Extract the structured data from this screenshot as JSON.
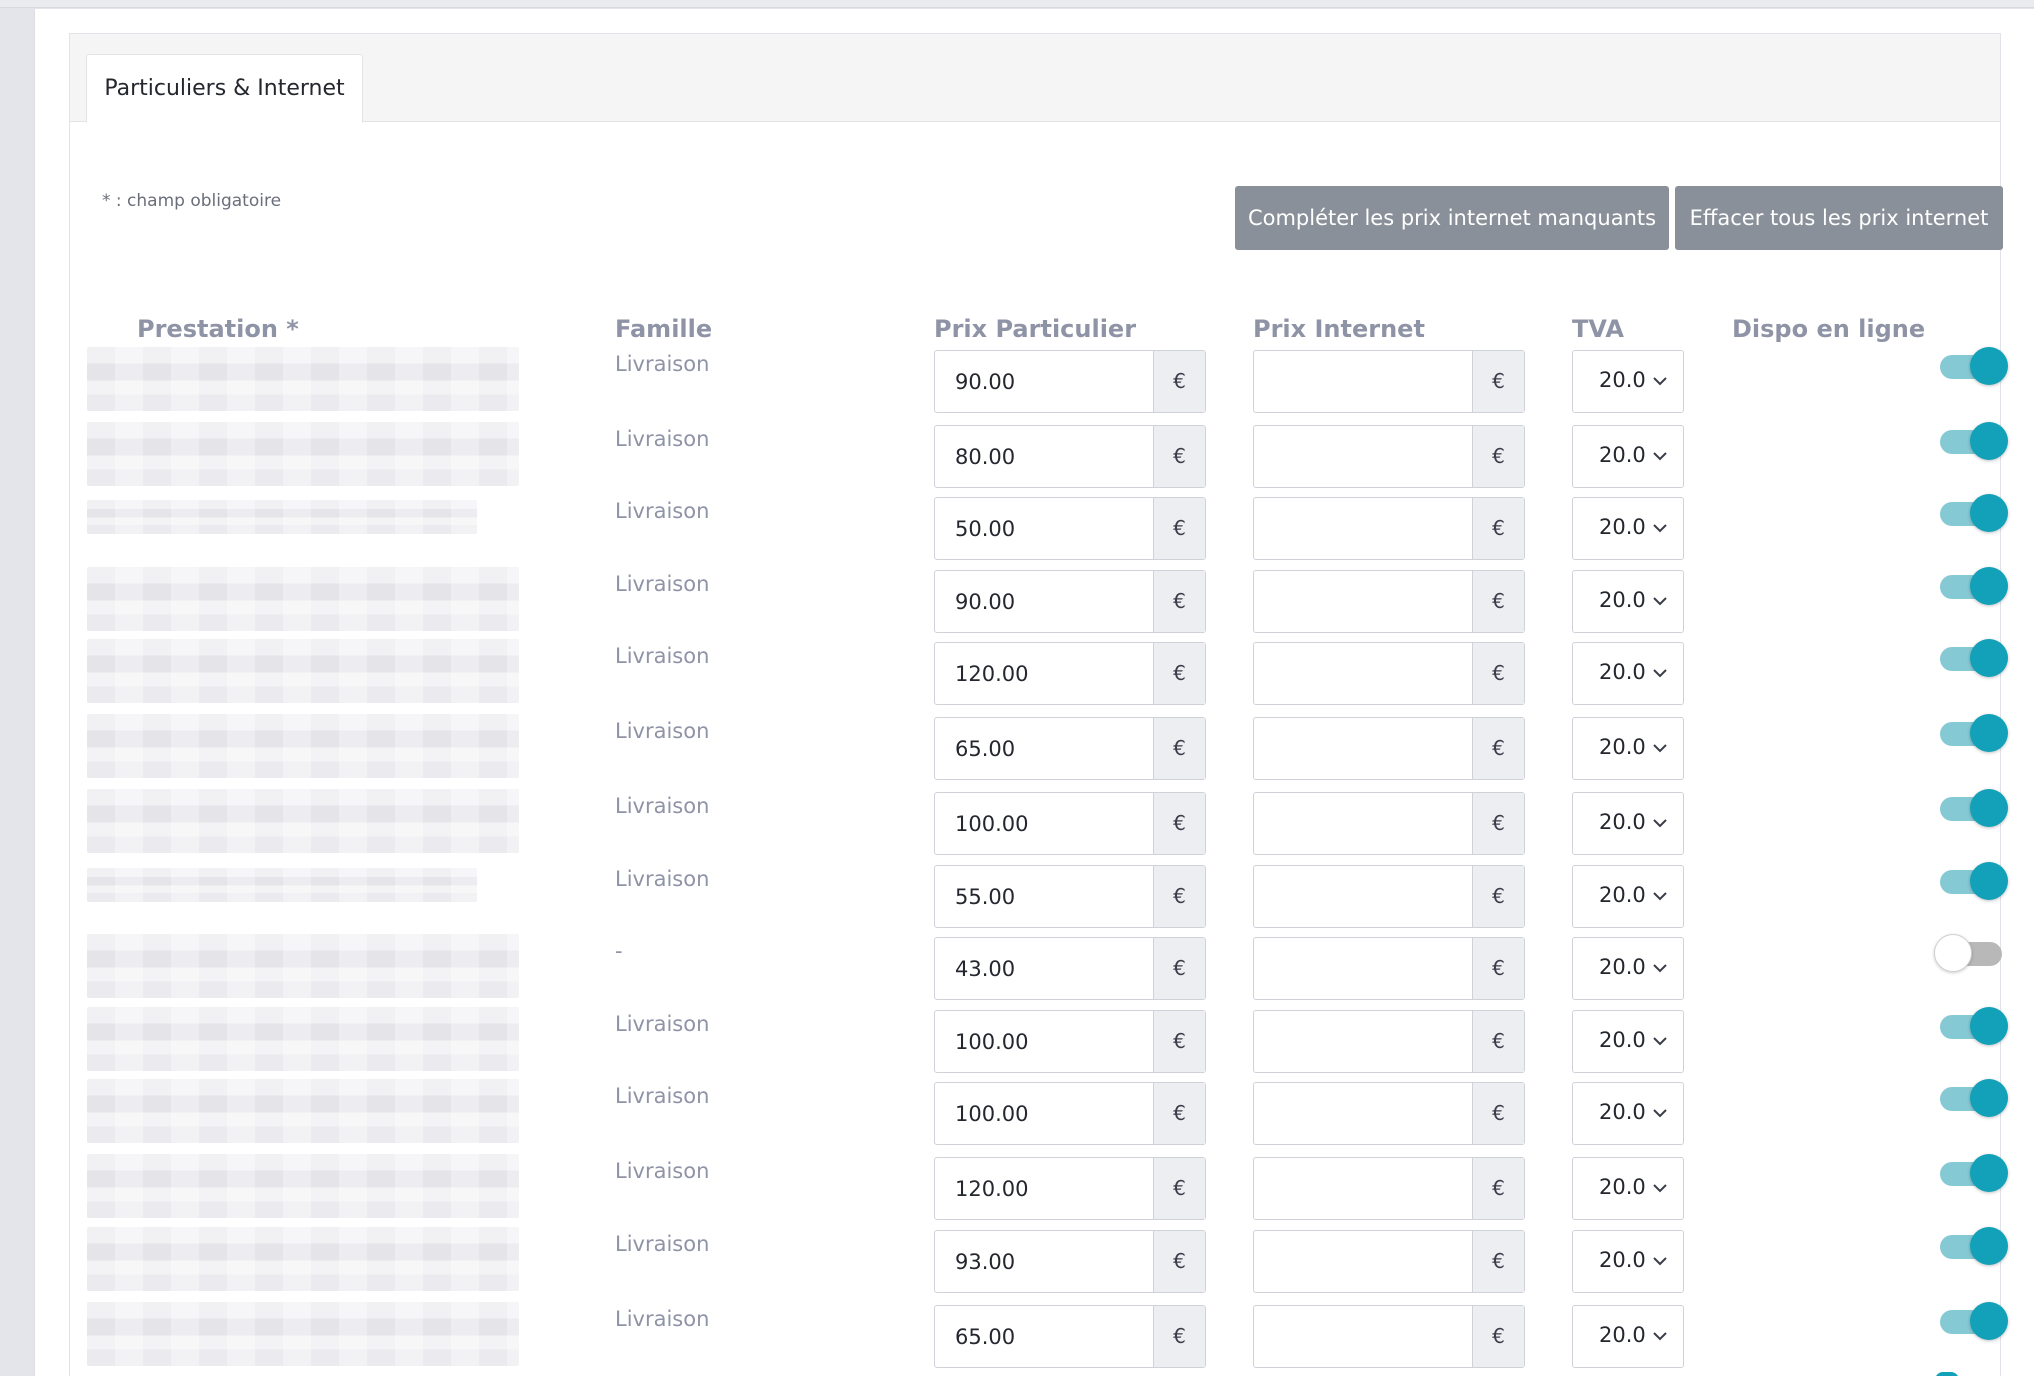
{
  "tab": {
    "label": "Particuliers & Internet"
  },
  "required_note": "* : champ obligatoire",
  "buttons": {
    "fill_missing": "Compléter les prix internet manquants",
    "clear_all": "Effacer tous les prix internet"
  },
  "columns": {
    "prestation": "Prestation *",
    "famille": "Famille",
    "prix_particulier": "Prix Particulier",
    "prix_internet": "Prix Internet",
    "tva": "TVA",
    "dispo": "Dispo en ligne"
  },
  "currency": "€",
  "rows": [
    {
      "famille": "Livraison",
      "prix_particulier": "90.00",
      "prix_internet": "",
      "tva": "20.0",
      "dispo": true
    },
    {
      "famille": "Livraison",
      "prix_particulier": "80.00",
      "prix_internet": "",
      "tva": "20.0",
      "dispo": true
    },
    {
      "famille": "Livraison",
      "prix_particulier": "50.00",
      "prix_internet": "",
      "tva": "20.0",
      "dispo": true
    },
    {
      "famille": "Livraison",
      "prix_particulier": "90.00",
      "prix_internet": "",
      "tva": "20.0",
      "dispo": true
    },
    {
      "famille": "Livraison",
      "prix_particulier": "120.00",
      "prix_internet": "",
      "tva": "20.0",
      "dispo": true
    },
    {
      "famille": "Livraison",
      "prix_particulier": "65.00",
      "prix_internet": "",
      "tva": "20.0",
      "dispo": true
    },
    {
      "famille": "Livraison",
      "prix_particulier": "100.00",
      "prix_internet": "",
      "tva": "20.0",
      "dispo": true
    },
    {
      "famille": "Livraison",
      "prix_particulier": "55.00",
      "prix_internet": "",
      "tva": "20.0",
      "dispo": true
    },
    {
      "famille": "-",
      "prix_particulier": "43.00",
      "prix_internet": "",
      "tva": "20.0",
      "dispo": false
    },
    {
      "famille": "Livraison",
      "prix_particulier": "100.00",
      "prix_internet": "",
      "tva": "20.0",
      "dispo": true
    },
    {
      "famille": "Livraison",
      "prix_particulier": "100.00",
      "prix_internet": "",
      "tva": "20.0",
      "dispo": true
    },
    {
      "famille": "Livraison",
      "prix_particulier": "120.00",
      "prix_internet": "",
      "tva": "20.0",
      "dispo": true
    },
    {
      "famille": "Livraison",
      "prix_particulier": "93.00",
      "prix_internet": "",
      "tva": "20.0",
      "dispo": true
    },
    {
      "famille": "Livraison",
      "prix_particulier": "65.00",
      "prix_internet": "",
      "tva": "20.0",
      "dispo": true
    }
  ]
}
